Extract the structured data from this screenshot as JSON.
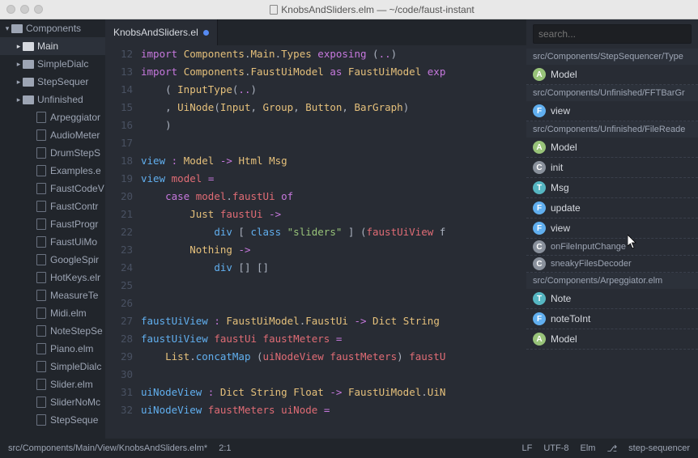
{
  "title": "KnobsAndSliders.elm — ~/code/faust-instant",
  "tab": {
    "label": "KnobsAndSliders.el"
  },
  "tree": {
    "root": "Components",
    "folders": [
      "Main",
      "SimpleDialc",
      "StepSequer",
      "Unfinished"
    ],
    "files": [
      "Arpeggiator",
      "AudioMeter",
      "DrumStepS",
      "Examples.e",
      "FaustCodeV",
      "FaustContr",
      "FaustProgr",
      "FaustUiMo",
      "GoogleSpir",
      "HotKeys.elr",
      "MeasureTe",
      "Midi.elm",
      "NoteStepSe",
      "Piano.elm",
      "SimpleDialc",
      "Slider.elm",
      "SliderNoMc",
      "StepSeque"
    ]
  },
  "gutter_start": 12,
  "code_lines": [
    [
      [
        "kw",
        "import"
      ],
      [
        "pl",
        " "
      ],
      [
        "ty",
        "Components"
      ],
      [
        "pl",
        "."
      ],
      [
        "ty",
        "Main"
      ],
      [
        "pl",
        "."
      ],
      [
        "ty",
        "Types"
      ],
      [
        "pl",
        " "
      ],
      [
        "kw",
        "exposing"
      ],
      [
        "pl",
        " ("
      ],
      [
        "op",
        ".."
      ],
      [
        "pl",
        ")"
      ]
    ],
    [
      [
        "kw",
        "import"
      ],
      [
        "pl",
        " "
      ],
      [
        "ty",
        "Components"
      ],
      [
        "pl",
        "."
      ],
      [
        "ty",
        "FaustUiModel"
      ],
      [
        "pl",
        " "
      ],
      [
        "kw",
        "as"
      ],
      [
        "pl",
        " "
      ],
      [
        "ty",
        "FaustUiModel"
      ],
      [
        "pl",
        " "
      ],
      [
        "kw",
        "exp"
      ]
    ],
    [
      [
        "pl",
        "    ( "
      ],
      [
        "ty",
        "InputType"
      ],
      [
        "pl",
        "("
      ],
      [
        "op",
        ".."
      ],
      [
        "pl",
        ")"
      ]
    ],
    [
      [
        "pl",
        "    , "
      ],
      [
        "ty",
        "UiNode"
      ],
      [
        "pl",
        "("
      ],
      [
        "ty",
        "Input"
      ],
      [
        "pl",
        ", "
      ],
      [
        "ty",
        "Group"
      ],
      [
        "pl",
        ", "
      ],
      [
        "ty",
        "Button"
      ],
      [
        "pl",
        ", "
      ],
      [
        "ty",
        "BarGraph"
      ],
      [
        "pl",
        ")"
      ]
    ],
    [
      [
        "pl",
        "    )"
      ]
    ],
    [],
    [
      [
        "fn",
        "view"
      ],
      [
        "pl",
        " "
      ],
      [
        "op",
        ":"
      ],
      [
        "pl",
        " "
      ],
      [
        "ty",
        "Model"
      ],
      [
        "pl",
        " "
      ],
      [
        "op",
        "->"
      ],
      [
        "pl",
        " "
      ],
      [
        "ty",
        "Html"
      ],
      [
        "pl",
        " "
      ],
      [
        "ty",
        "Msg"
      ]
    ],
    [
      [
        "fn",
        "view"
      ],
      [
        "pl",
        " "
      ],
      [
        "id",
        "model"
      ],
      [
        "pl",
        " "
      ],
      [
        "op",
        "="
      ]
    ],
    [
      [
        "pl",
        "    "
      ],
      [
        "kw",
        "case"
      ],
      [
        "pl",
        " "
      ],
      [
        "id",
        "model"
      ],
      [
        "pl",
        "."
      ],
      [
        "id",
        "faustUi"
      ],
      [
        "pl",
        " "
      ],
      [
        "kw",
        "of"
      ]
    ],
    [
      [
        "pl",
        "        "
      ],
      [
        "ty",
        "Just"
      ],
      [
        "pl",
        " "
      ],
      [
        "id",
        "faustUi"
      ],
      [
        "pl",
        " "
      ],
      [
        "op",
        "->"
      ]
    ],
    [
      [
        "pl",
        "            "
      ],
      [
        "fn",
        "div"
      ],
      [
        "pl",
        " [ "
      ],
      [
        "fn",
        "class"
      ],
      [
        "pl",
        " "
      ],
      [
        "str",
        "\"sliders\""
      ],
      [
        "pl",
        " ] ("
      ],
      [
        "id",
        "faustUiView"
      ],
      [
        "pl",
        " f"
      ]
    ],
    [
      [
        "pl",
        "        "
      ],
      [
        "ty",
        "Nothing"
      ],
      [
        "pl",
        " "
      ],
      [
        "op",
        "->"
      ]
    ],
    [
      [
        "pl",
        "            "
      ],
      [
        "fn",
        "div"
      ],
      [
        "pl",
        " [] []"
      ]
    ],
    [],
    [],
    [
      [
        "fn",
        "faustUiView"
      ],
      [
        "pl",
        " "
      ],
      [
        "op",
        ":"
      ],
      [
        "pl",
        " "
      ],
      [
        "ty",
        "FaustUiModel"
      ],
      [
        "pl",
        "."
      ],
      [
        "ty",
        "FaustUi"
      ],
      [
        "pl",
        " "
      ],
      [
        "op",
        "->"
      ],
      [
        "pl",
        " "
      ],
      [
        "ty",
        "Dict"
      ],
      [
        "pl",
        " "
      ],
      [
        "ty",
        "String"
      ]
    ],
    [
      [
        "fn",
        "faustUiView"
      ],
      [
        "pl",
        " "
      ],
      [
        "id",
        "faustUi"
      ],
      [
        "pl",
        " "
      ],
      [
        "id",
        "faustMeters"
      ],
      [
        "pl",
        " "
      ],
      [
        "op",
        "="
      ]
    ],
    [
      [
        "pl",
        "    "
      ],
      [
        "ty",
        "List"
      ],
      [
        "pl",
        "."
      ],
      [
        "fn",
        "concatMap"
      ],
      [
        "pl",
        " ("
      ],
      [
        "id",
        "uiNodeView"
      ],
      [
        "pl",
        " "
      ],
      [
        "id",
        "faustMeters"
      ],
      [
        "pl",
        ") "
      ],
      [
        "id",
        "faustU"
      ]
    ],
    [],
    [
      [
        "fn",
        "uiNodeView"
      ],
      [
        "pl",
        " "
      ],
      [
        "op",
        ":"
      ],
      [
        "pl",
        " "
      ],
      [
        "ty",
        "Dict"
      ],
      [
        "pl",
        " "
      ],
      [
        "ty",
        "String"
      ],
      [
        "pl",
        " "
      ],
      [
        "ty",
        "Float"
      ],
      [
        "pl",
        " "
      ],
      [
        "op",
        "->"
      ],
      [
        "pl",
        " "
      ],
      [
        "ty",
        "FaustUiModel"
      ],
      [
        "pl",
        "."
      ],
      [
        "ty",
        "UiN"
      ]
    ],
    [
      [
        "fn",
        "uiNodeView"
      ],
      [
        "pl",
        " "
      ],
      [
        "id",
        "faustMeters"
      ],
      [
        "pl",
        " "
      ],
      [
        "id",
        "uiNode"
      ],
      [
        "pl",
        " "
      ],
      [
        "op",
        "="
      ]
    ]
  ],
  "search": {
    "placeholder": "search..."
  },
  "results": [
    {
      "type": "head",
      "text": "src/Components/StepSequencer/Type"
    },
    {
      "type": "item",
      "badge": "A",
      "text": "Model"
    },
    {
      "type": "head",
      "text": "src/Components/Unfinished/FFTBarGr"
    },
    {
      "type": "item",
      "badge": "F",
      "text": "view"
    },
    {
      "type": "head",
      "text": "src/Components/Unfinished/FileReade"
    },
    {
      "type": "item",
      "badge": "A",
      "text": "Model"
    },
    {
      "type": "item",
      "badge": "C",
      "text": "init"
    },
    {
      "type": "item",
      "badge": "T",
      "text": "Msg"
    },
    {
      "type": "item",
      "badge": "F",
      "text": "update"
    },
    {
      "type": "item",
      "badge": "F",
      "text": "view"
    },
    {
      "type": "sub",
      "badge": "C",
      "text": "onFileInputChange"
    },
    {
      "type": "sub",
      "badge": "C",
      "text": "sneakyFilesDecoder"
    },
    {
      "type": "head",
      "text": "src/Components/Arpeggiator.elm"
    },
    {
      "type": "item",
      "badge": "T",
      "text": "Note"
    },
    {
      "type": "item",
      "badge": "F",
      "text": "noteToInt"
    },
    {
      "type": "item",
      "badge": "A",
      "text": "Model"
    }
  ],
  "status": {
    "path": "src/Components/Main/View/KnobsAndSliders.elm*",
    "pos": "2:1",
    "eol": "LF",
    "enc": "UTF-8",
    "lang": "Elm",
    "branch": "step-sequencer"
  }
}
